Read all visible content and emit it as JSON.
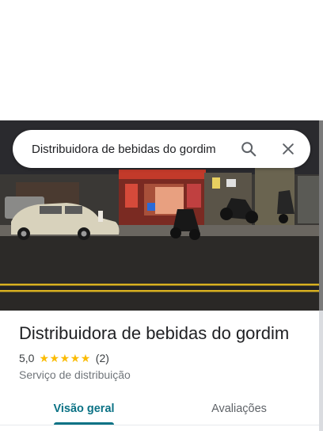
{
  "search": {
    "query": "Distribuidora de bebidas do gordim",
    "search_icon": "search-icon",
    "close_icon": "close-icon"
  },
  "photo": {
    "icon": "storefront-night-photo"
  },
  "place": {
    "name": "Distribuidora de bebidas do gordim",
    "rating": "5,0",
    "rating_stars": 5,
    "review_count": "(2)",
    "category": "Serviço de distribuição"
  },
  "tabs": [
    {
      "label": "Visão geral",
      "selected": true
    },
    {
      "label": "Avaliações",
      "selected": false
    }
  ],
  "colors": {
    "accent": "#0b7285",
    "star": "#fbbc04",
    "text_primary": "#202124",
    "text_secondary": "#70757a"
  }
}
